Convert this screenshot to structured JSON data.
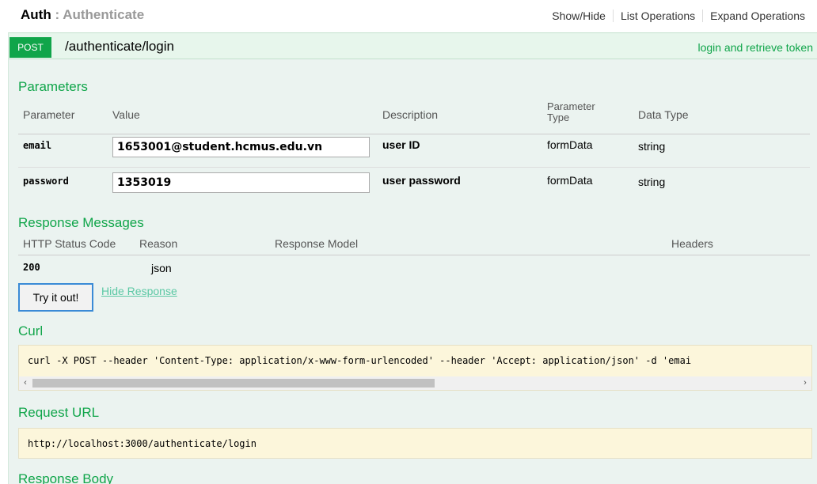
{
  "resource": {
    "name": "Auth",
    "separator": ":",
    "subtitle": "Authenticate",
    "ops": [
      "Show/Hide",
      "List Operations",
      "Expand Operations"
    ]
  },
  "operation": {
    "method": "POST",
    "path": "/authenticate/login",
    "summary": "login and retrieve token"
  },
  "parameters": {
    "title": "Parameters",
    "headers": {
      "parameter": "Parameter",
      "value": "Value",
      "description": "Description",
      "param_type_1": "Parameter",
      "param_type_2": "Type",
      "data_type": "Data Type"
    },
    "rows": [
      {
        "name": "email",
        "value": "1653001@student.hcmus.edu.vn",
        "description": "user ID",
        "param_type": "formData",
        "data_type": "string"
      },
      {
        "name": "password",
        "value": "1353019",
        "description": "user password",
        "param_type": "formData",
        "data_type": "string"
      }
    ]
  },
  "responses": {
    "title": "Response Messages",
    "headers": {
      "status": "HTTP Status Code",
      "reason": "Reason",
      "model": "Response Model",
      "headers": "Headers"
    },
    "rows": [
      {
        "status": "200",
        "reason": "json"
      }
    ]
  },
  "actions": {
    "try_label": "Try it out!",
    "hide_label": "Hide Response"
  },
  "curl": {
    "title": "Curl",
    "command": "curl -X POST --header 'Content-Type: application/x-www-form-urlencoded' --header 'Accept: application/json' -d 'emai"
  },
  "request_url": {
    "title": "Request URL",
    "url": "http://localhost:3000/authenticate/login"
  },
  "response_body": {
    "title": "Response Body"
  }
}
